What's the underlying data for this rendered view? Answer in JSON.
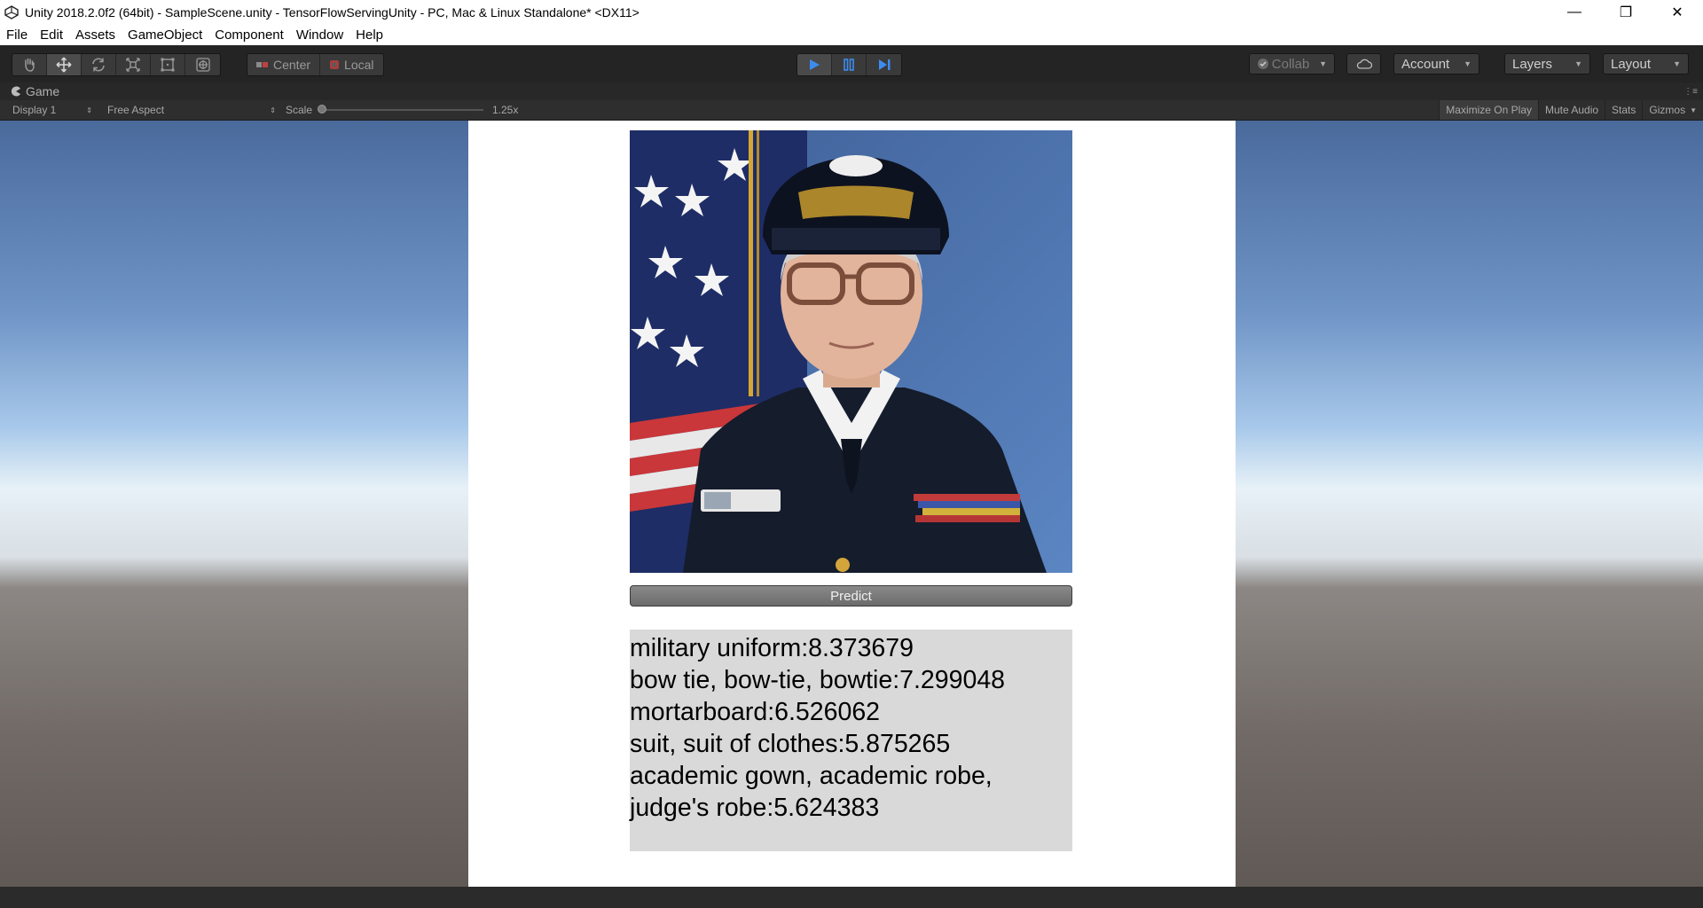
{
  "window": {
    "title": "Unity 2018.2.0f2 (64bit) - SampleScene.unity - TensorFlowServingUnity - PC, Mac & Linux Standalone* <DX11>",
    "minimize": "—",
    "maximize": "❐",
    "close": "✕"
  },
  "menu": [
    "File",
    "Edit",
    "Assets",
    "GameObject",
    "Component",
    "Window",
    "Help"
  ],
  "toolbar": {
    "tools": [
      "hand-tool",
      "move-tool",
      "rotate-tool",
      "scale-tool",
      "rect-tool",
      "transform-tool"
    ],
    "active_tool": "move-tool",
    "pivot_center": "Center",
    "pivot_local": "Local",
    "play_state": "playing",
    "collab": "Collab",
    "account": "Account",
    "layers": "Layers",
    "layout": "Layout",
    "accent_color": "#3c8cf0"
  },
  "game_view": {
    "tab_label": "Game",
    "display": "Display 1",
    "aspect": "Free Aspect",
    "scale_label": "Scale",
    "scale_value": "1.25x",
    "maximize_on_play": "Maximize On Play",
    "mute_audio": "Mute Audio",
    "stats": "Stats",
    "gizmos": "Gizmos"
  },
  "app": {
    "photo_subject": "portrait of a naval officer in uniform in front of a US flag",
    "predict_label": "Predict",
    "results": [
      "military uniform:8.373679",
      "bow tie, bow-tie, bowtie:7.299048",
      "mortarboard:6.526062",
      "suit, suit of clothes:5.875265",
      "academic gown, academic robe,",
      "judge's robe:5.624383"
    ]
  }
}
